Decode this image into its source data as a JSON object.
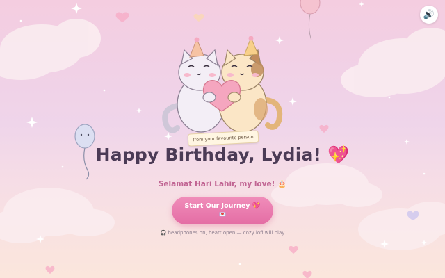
{
  "sound_button": {
    "icon": "speaker-icon",
    "glyph": "🔊"
  },
  "tag": {
    "text": "from your favourite person"
  },
  "title": {
    "text": "Happy Birthday, Lydia! 💖"
  },
  "subtitle": {
    "text": "Selamat Hari Lahir, my love! 🎂"
  },
  "start_button": {
    "label": "Start Our Journey 💖",
    "sub_glyph": "💌"
  },
  "hint": {
    "text": "🎧 headphones on, heart open — cozy lofi will play"
  },
  "colors": {
    "accent_pink": "#e46da4",
    "title_color": "#4b3b56",
    "subtitle_color": "#c06492"
  }
}
